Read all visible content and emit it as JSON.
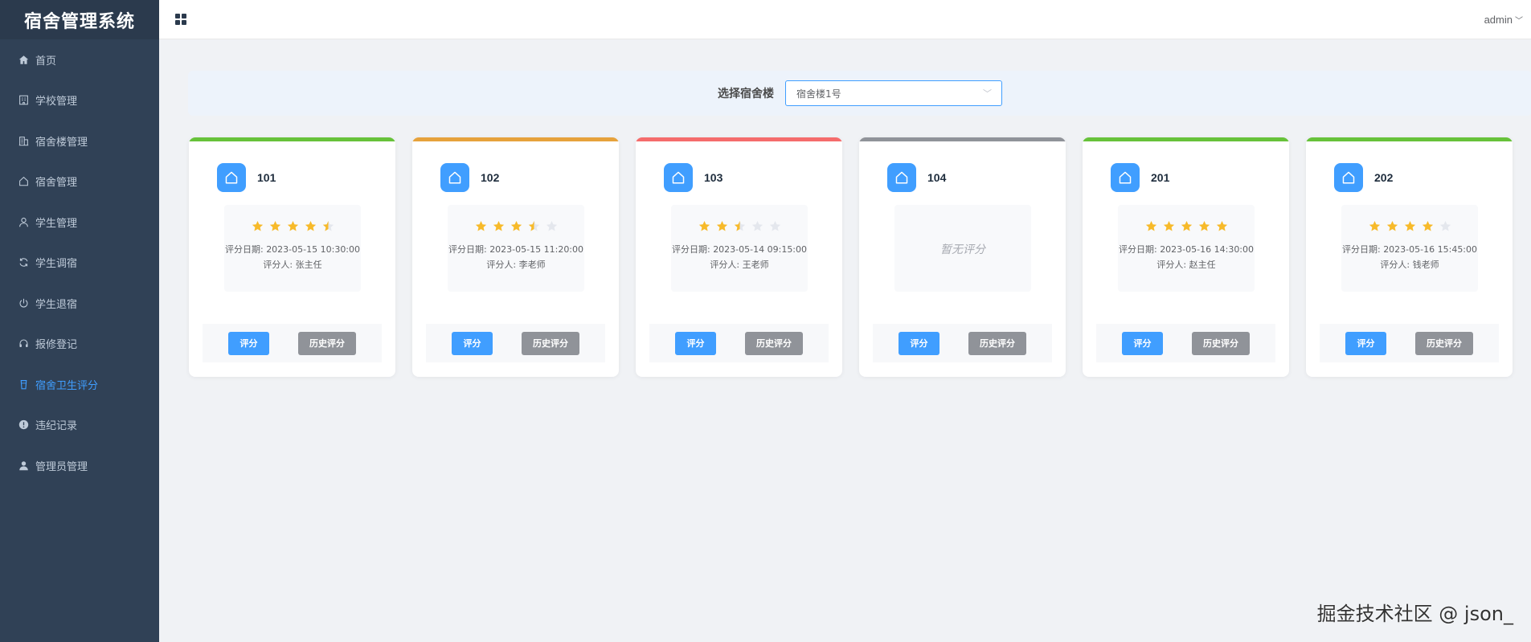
{
  "app": {
    "title": "宿舍管理系统"
  },
  "header": {
    "user": "admin"
  },
  "sidebar": {
    "items": [
      {
        "label": "首页",
        "icon": "home-icon",
        "active": false
      },
      {
        "label": "学校管理",
        "icon": "school-icon",
        "active": false
      },
      {
        "label": "宿舍楼管理",
        "icon": "building-icon",
        "active": false
      },
      {
        "label": "宿舍管理",
        "icon": "house-icon",
        "active": false
      },
      {
        "label": "学生管理",
        "icon": "user-icon",
        "active": false
      },
      {
        "label": "学生调宿",
        "icon": "refresh-icon",
        "active": false
      },
      {
        "label": "学生退宿",
        "icon": "power-icon",
        "active": false
      },
      {
        "label": "报修登记",
        "icon": "headset-icon",
        "active": false
      },
      {
        "label": "宿舍卫生评分",
        "icon": "cup-icon",
        "active": true
      },
      {
        "label": "违纪记录",
        "icon": "warning-icon",
        "active": false
      },
      {
        "label": "管理员管理",
        "icon": "admin-icon",
        "active": false
      }
    ]
  },
  "filter": {
    "label": "选择宿舍楼",
    "selected": "宿舍楼1号"
  },
  "buttons": {
    "rate": "评分",
    "history": "历史评分"
  },
  "labels": {
    "date_prefix": "评分日期: ",
    "rater_prefix": "评分人: ",
    "no_score": "暂无评分"
  },
  "colors": {
    "accent": "#409eff",
    "sidebar_bg": "#304156",
    "star": "#f7ba2a",
    "star_empty": "#e4e7ed"
  },
  "rooms": [
    {
      "number": "101",
      "rating": 4.5,
      "date": "2023-05-15 10:30:00",
      "rater": "张主任",
      "status_color": "#67c23a"
    },
    {
      "number": "102",
      "rating": 3.5,
      "date": "2023-05-15 11:20:00",
      "rater": "李老师",
      "status_color": "#e6a23c"
    },
    {
      "number": "103",
      "rating": 2.5,
      "date": "2023-05-14 09:15:00",
      "rater": "王老师",
      "status_color": "#f56c6c"
    },
    {
      "number": "104",
      "rating": null,
      "date": "",
      "rater": "",
      "status_color": "#909399"
    },
    {
      "number": "201",
      "rating": 5,
      "date": "2023-05-16 14:30:00",
      "rater": "赵主任",
      "status_color": "#67c23a"
    },
    {
      "number": "202",
      "rating": 4,
      "date": "2023-05-16 15:45:00",
      "rater": "钱老师",
      "status_color": "#67c23a"
    }
  ],
  "watermark": "掘金技术社区 @ json_"
}
